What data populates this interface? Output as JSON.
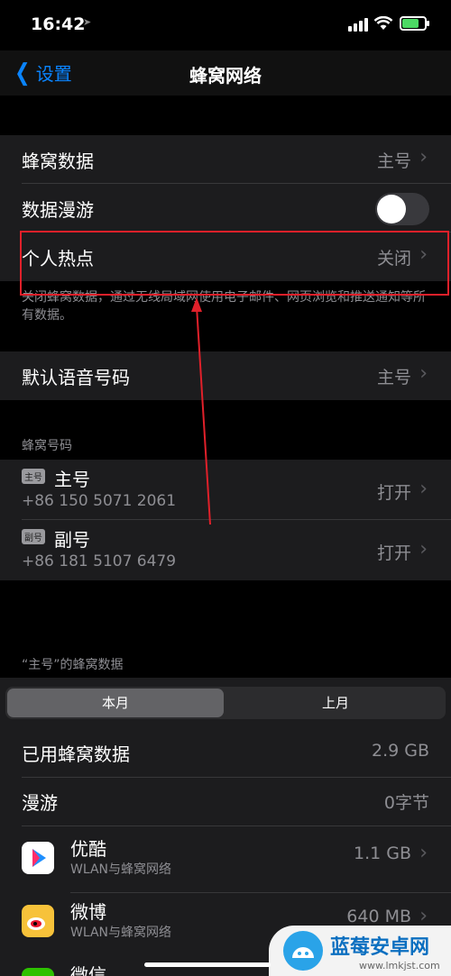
{
  "status": {
    "time": "16:42"
  },
  "nav": {
    "back_label": "设置",
    "title": "蜂窝网络"
  },
  "group1": {
    "cellular_data": {
      "label": "蜂窝数据",
      "value": "主号"
    },
    "roaming": {
      "label": "数据漫游"
    },
    "hotspot": {
      "label": "个人热点",
      "value": "关闭"
    }
  },
  "footnote": "关闭蜂窝数据，通过无线局域网使用电子邮件、网页浏览和推送通知等所有数据。",
  "default_voice": {
    "label": "默认语音号码",
    "value": "主号"
  },
  "sims": {
    "header": "蜂窝号码",
    "items": [
      {
        "badge": "主号",
        "name": "主号",
        "number": "+86 150 5071 2061",
        "value": "打开"
      },
      {
        "badge": "副号",
        "name": "副号",
        "number": "+86 181 5107 6479",
        "value": "打开"
      }
    ]
  },
  "usage": {
    "header": "“主号”的蜂窝数据",
    "tabs": [
      "本月",
      "上月"
    ],
    "used": {
      "label": "已用蜂窝数据",
      "value": "2.9 GB"
    },
    "roaming": {
      "label": "漫游",
      "value": "0字节"
    }
  },
  "apps": [
    {
      "name": "优酷",
      "sub": "WLAN与蜂窝网络",
      "value": "1.1 GB",
      "color": "#1f8fff"
    },
    {
      "name": "微博",
      "sub": "WLAN与蜂窝网络",
      "value": "640 MB",
      "color": "#f7c23a"
    },
    {
      "name": "微信",
      "sub": "",
      "value": "",
      "color": "#2dc100"
    }
  ],
  "watermark": {
    "title": "蓝莓安卓网",
    "url": "www.lmkjst.com"
  }
}
